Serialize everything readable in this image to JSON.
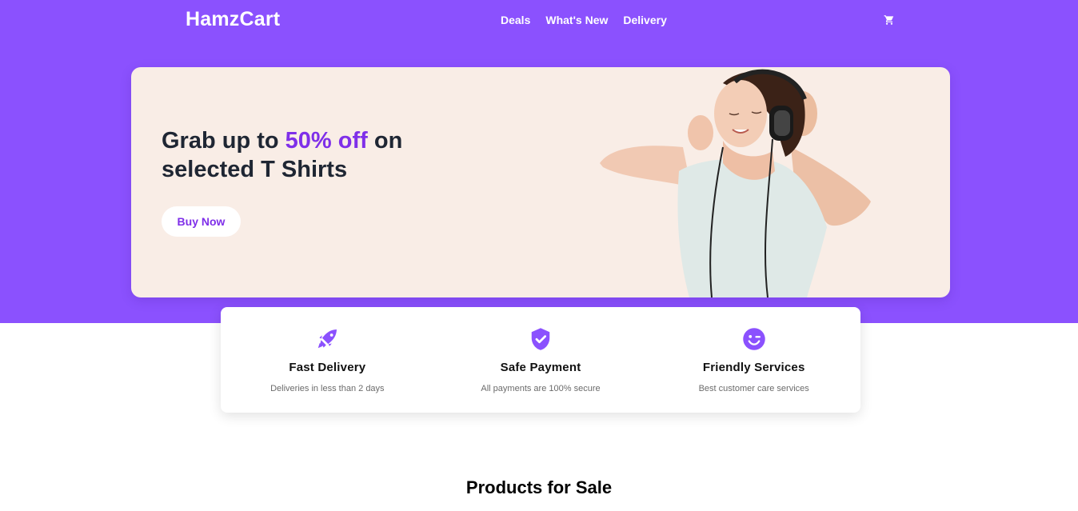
{
  "header": {
    "brand": "HamzCart",
    "nav": [
      "Deals",
      "What's New",
      "Delivery"
    ],
    "cart_icon": "cart-icon"
  },
  "hero": {
    "title_part1": "Grab up to ",
    "title_highlight": "50% off",
    "title_part2": " on selected T Shirts",
    "cta_label": "Buy Now",
    "image": "woman-with-headphones"
  },
  "features": [
    {
      "icon": "rocket-icon",
      "title": "Fast Delivery",
      "desc": "Deliveries in less than 2 days"
    },
    {
      "icon": "shield-check-icon",
      "title": "Safe Payment",
      "desc": "All payments are 100% secure"
    },
    {
      "icon": "wink-smile-icon",
      "title": "Friendly Services",
      "desc": "Best customer care services"
    }
  ],
  "products": {
    "title": "Products for Sale"
  },
  "colors": {
    "primary": "#8b51fe",
    "accent": "#7f2fe9",
    "hero_bg": "#f9ede6",
    "text_dark": "#1f2633"
  }
}
